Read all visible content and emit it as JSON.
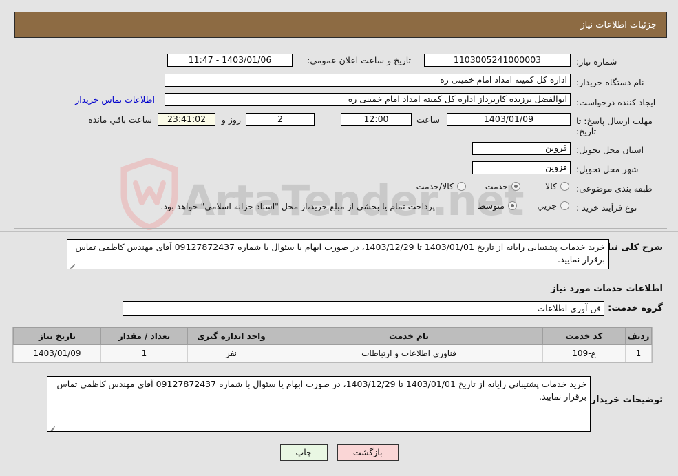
{
  "header": {
    "title": "جزئیات اطلاعات نیاز"
  },
  "form": {
    "need_number_label": "شماره نیاز:",
    "need_number_value": "1103005241000003",
    "announce_label": "تاریخ و ساعت اعلان عمومی:",
    "announce_value": "1403/01/06 - 11:47",
    "buyer_org_label": "نام دستگاه خریدار:",
    "buyer_org_value": "اداره کل کمیته امداد امام خمینی  ره",
    "creator_label": "ایجاد کننده درخواست:",
    "creator_value": "ابوالفضل برزیده کاربرداز اداره کل کمیته امداد امام خمینی  ره",
    "contact_link": "اطلاعات تماس خریدار",
    "deadline_label": "مهلت ارسال پاسخ: تا تاریخ:",
    "deadline_date": "1403/01/09",
    "deadline_hour_label": "ساعت",
    "deadline_hour_value": "12:00",
    "days_value": "2",
    "days_label": "روز و",
    "countdown_value": "23:41:02",
    "countdown_label": "ساعت باقي مانده",
    "province_label": "استان محل تحویل:",
    "province_value": "قزوین",
    "city_label": "شهر محل تحویل:",
    "city_value": "قزوین",
    "category_label": "طبقه بندی موضوعی:",
    "category_options": [
      {
        "label": "کالا",
        "selected": false
      },
      {
        "label": "خدمت",
        "selected": true
      },
      {
        "label": "کالا/خدمت",
        "selected": false
      }
    ],
    "process_label": "نوع فرآیند خرید :",
    "process_options": [
      {
        "label": "جزیي",
        "selected": false
      },
      {
        "label": "متوسط",
        "selected": true
      }
    ],
    "process_note": "پرداخت تمام یا بخشی از مبلغ خرید،از محل \"اسناد خزانه اسلامی\" خواهد بود."
  },
  "description": {
    "label": "شرح کلی نیاز:",
    "value": "خرید خدمات پشتیبانی رایانه از تاریخ 1403/01/01 تا 1403/12/29، در صورت ابهام یا سئوال با شماره 09127872437 آقای مهندس کاظمی تماس برقرار نمایید."
  },
  "services_section": {
    "heading": "اطلاعات خدمات مورد نیاز",
    "group_label": "گروه خدمت:",
    "group_value": "فن آوری اطلاعات"
  },
  "table": {
    "columns": [
      "ردیف",
      "کد خدمت",
      "نام خدمت",
      "واحد اندازه گیری",
      "تعداد / مقدار",
      "تاریخ نیاز"
    ],
    "rows": [
      [
        "1",
        "غ-109",
        "فناوری اطلاعات و ارتباطات",
        "نفر",
        "1",
        "1403/01/09"
      ]
    ]
  },
  "buyer_notes": {
    "label": "توضیحات خریدار:",
    "value": "خرید خدمات پشتیبانی رایانه از تاریخ 1403/01/01 تا 1403/12/29، در صورت ابهام یا سئوال با شماره 09127872437 آقای مهندس کاظمی تماس برقرار نمایید."
  },
  "footer": {
    "print_label": "چاپ",
    "back_label": "بازگشت"
  },
  "watermark": {
    "text": "ArtaTender.net"
  },
  "colors": {
    "header_bg": "#8d6b43",
    "page_bg": "#e4e4e4",
    "link": "#0000cc",
    "print_btn": "#e9f7e3",
    "back_btn": "#fad6d6",
    "countdown_bg": "#fbfbe8"
  }
}
